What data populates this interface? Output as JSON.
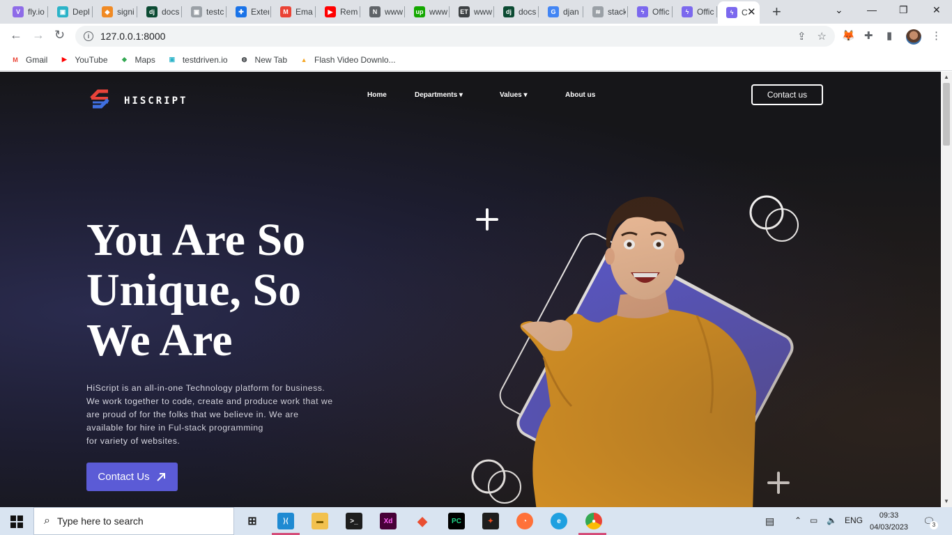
{
  "browser": {
    "tabs": [
      {
        "label": "fly.io",
        "color": "#8e6be8",
        "glyph": "V"
      },
      {
        "label": "Depl",
        "color": "#2bb3c8",
        "glyph": "▣"
      },
      {
        "label": "signi",
        "color": "#f08a24",
        "glyph": "◆"
      },
      {
        "label": "docs",
        "color": "#0c4b33",
        "glyph": "dj"
      },
      {
        "label": "testc",
        "color": "#9aa0a6",
        "glyph": "▣"
      },
      {
        "label": "Exter",
        "color": "#1a73e8",
        "glyph": "✚"
      },
      {
        "label": "Ema",
        "color": "#ea4335",
        "glyph": "M"
      },
      {
        "label": "Rem",
        "color": "#ff0000",
        "glyph": "▶"
      },
      {
        "label": "www",
        "color": "#5f6368",
        "glyph": "N"
      },
      {
        "label": "www",
        "color": "#14a800",
        "glyph": "up"
      },
      {
        "label": "www",
        "color": "#3c4043",
        "glyph": "ET"
      },
      {
        "label": "docs",
        "color": "#0c4b33",
        "glyph": "dj"
      },
      {
        "label": "djan",
        "color": "#4285f4",
        "glyph": "G"
      },
      {
        "label": "stack",
        "color": "#9aa0a6",
        "glyph": "≋"
      },
      {
        "label": "Offic",
        "color": "#7b68ee",
        "glyph": "ϟ"
      },
      {
        "label": "Offic",
        "color": "#7b68ee",
        "glyph": "ϟ"
      },
      {
        "label": "C",
        "color": "#7b68ee",
        "glyph": "ϟ"
      }
    ],
    "url": "127.0.0.1:8000",
    "bookmarks": [
      {
        "label": "Gmail",
        "glyph": "M",
        "color": "#ea4335"
      },
      {
        "label": "YouTube",
        "glyph": "▶",
        "color": "#ff0000"
      },
      {
        "label": "Maps",
        "glyph": "◆",
        "color": "#34a853"
      },
      {
        "label": "testdriven.io",
        "glyph": "▣",
        "color": "#2bb3c8"
      },
      {
        "label": "New Tab",
        "glyph": "◍",
        "color": "#3c4043"
      },
      {
        "label": "Flash Video Downlo...",
        "glyph": "▲",
        "color": "#f5a623"
      }
    ]
  },
  "site": {
    "brand": "HISCRIPT",
    "nav": {
      "home": "Home",
      "departments": "Departments ▾",
      "values": "Values ▾",
      "about": "About us"
    },
    "contact_top": "Contact us",
    "hero": {
      "title_lines": [
        "You Are So",
        "Unique, So",
        "We Are"
      ],
      "body_lines": [
        "HiScript is an all-in-one Technology platform for business.",
        "We work together to code, create and produce work that we",
        "are proud of for the folks that we believe in. We are",
        "available for hire in Ful-stack programming",
        "for variety of websites."
      ],
      "cta": "Contact Us"
    },
    "colors": {
      "accent": "#5b5bd6",
      "brand_red": "#e8433a",
      "brand_blue": "#3f6fe0",
      "sweater": "#eea124"
    }
  },
  "taskbar": {
    "search_placeholder": "Type here to search",
    "lang": "ENG",
    "time": "09:33",
    "date": "04/03/2023",
    "notifications": "3"
  }
}
